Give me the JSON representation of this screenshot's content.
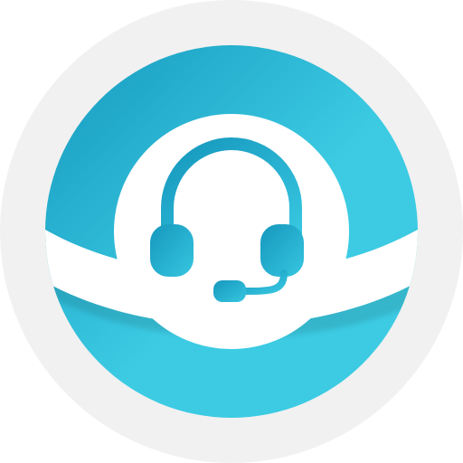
{
  "icon": {
    "name": "customer-support-headset-icon",
    "colors": {
      "background": "#ffffff",
      "outer_circle": "#f1f1f1",
      "ring_dark": "#1497bd",
      "ring_light": "#3ccbe3",
      "inner_disc": "#ffffff",
      "headset_dark": "#1597bd",
      "headset_light": "#37c6e0"
    }
  }
}
